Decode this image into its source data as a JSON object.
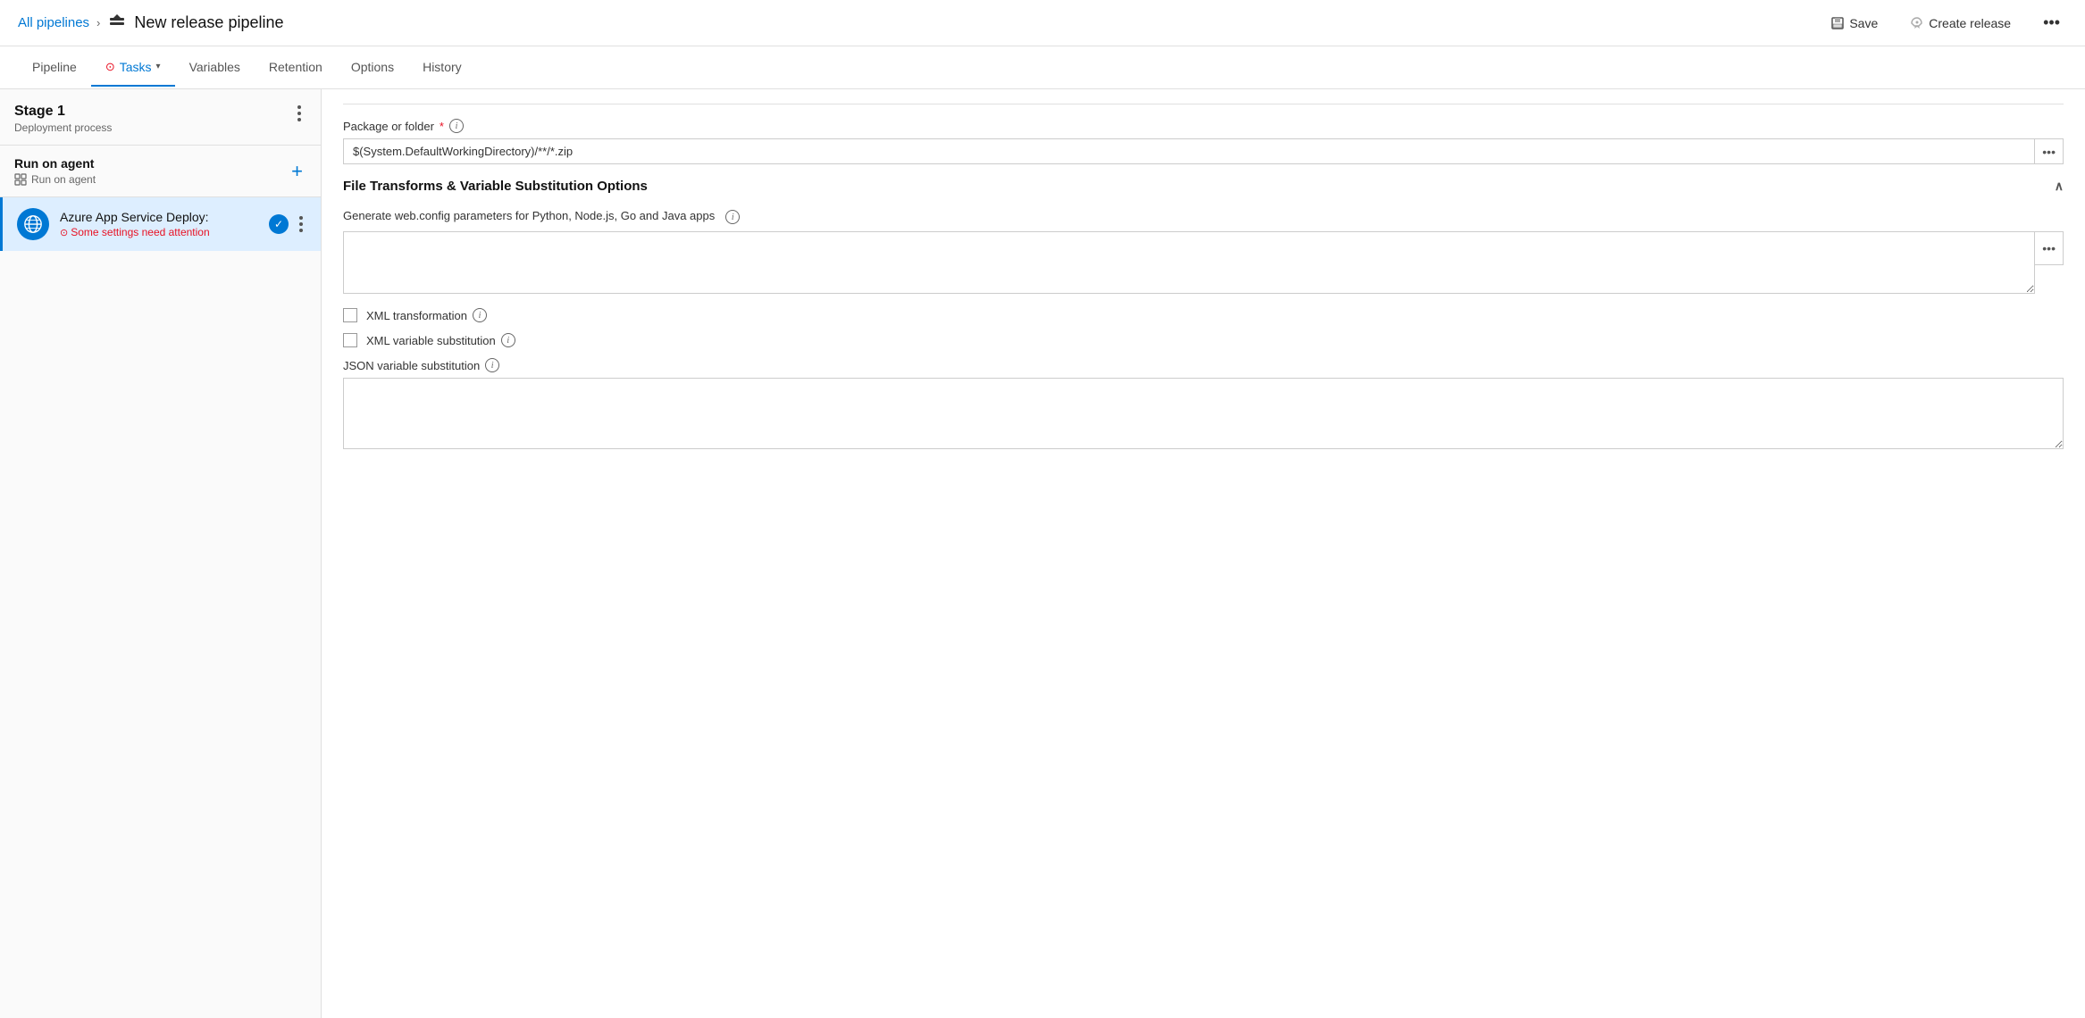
{
  "header": {
    "all_pipelines_label": "All pipelines",
    "page_title": "New release pipeline",
    "save_label": "Save",
    "create_release_label": "Create release"
  },
  "nav": {
    "tabs": [
      {
        "id": "pipeline",
        "label": "Pipeline",
        "active": false,
        "has_warning": false,
        "has_chevron": false
      },
      {
        "id": "tasks",
        "label": "Tasks",
        "active": true,
        "has_warning": true,
        "has_chevron": true
      },
      {
        "id": "variables",
        "label": "Variables",
        "active": false,
        "has_warning": false,
        "has_chevron": false
      },
      {
        "id": "retention",
        "label": "Retention",
        "active": false,
        "has_warning": false,
        "has_chevron": false
      },
      {
        "id": "options",
        "label": "Options",
        "active": false,
        "has_warning": false,
        "has_chevron": false
      },
      {
        "id": "history",
        "label": "History",
        "active": false,
        "has_warning": false,
        "has_chevron": false
      }
    ]
  },
  "left_panel": {
    "stage": {
      "title": "Stage 1",
      "subtitle": "Deployment process"
    },
    "agent": {
      "title": "Run on agent",
      "subtitle": "Run on agent"
    },
    "task": {
      "name": "Azure App Service Deploy:",
      "warning": "Some settings need attention"
    }
  },
  "right_panel": {
    "package_folder": {
      "label": "Package or folder",
      "value": "$(System.DefaultWorkingDirectory)/**/*.zip"
    },
    "file_transforms": {
      "section_title": "File Transforms & Variable Substitution Options",
      "description": "Generate web.config parameters for Python, Node.js, Go and Java apps",
      "xml_transformation": {
        "label": "XML transformation"
      },
      "xml_variable_substitution": {
        "label": "XML variable substitution"
      },
      "json_variable_substitution": {
        "label": "JSON variable substitution"
      }
    }
  }
}
